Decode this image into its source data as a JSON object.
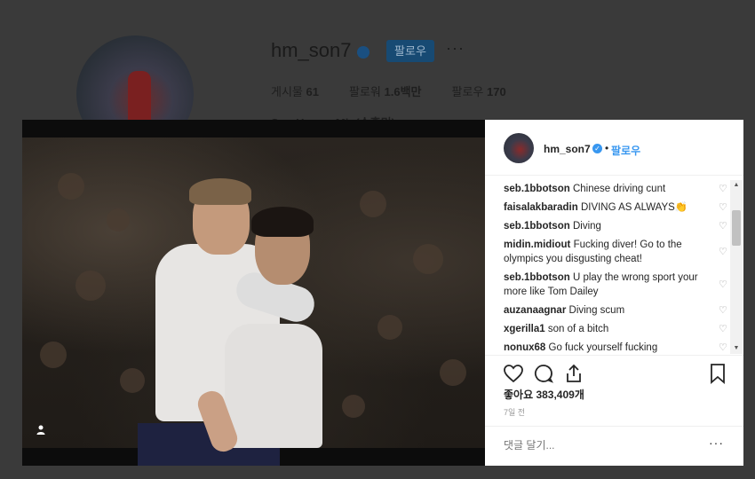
{
  "profile": {
    "username": "hm_son7",
    "follow_label": "팔로우",
    "more_label": "···",
    "stats": [
      {
        "label": "게시물",
        "value": "61"
      },
      {
        "label": "팔로워",
        "value": "1.6백만"
      },
      {
        "label": "팔로우",
        "value": "170"
      }
    ],
    "bio": "Son Heung-Min(손흥민)"
  },
  "post": {
    "username": "hm_son7",
    "follow_label": "팔로우",
    "separator": "•",
    "comments": [
      {
        "user": "seb.1bbotson",
        "text": "Chinese driving cunt"
      },
      {
        "user": "faisalakbaradin",
        "text": "DIVING AS ALWAYS👏"
      },
      {
        "user": "seb.1bbotson",
        "text": "Diving"
      },
      {
        "user": "midin.midiout",
        "text": "Fucking diver! Go to the olympics you disgusting cheat!"
      },
      {
        "user": "seb.1bbotson",
        "text": "U play the wrong sport your more like Tom Dailey"
      },
      {
        "user": "auzanaagnar",
        "text": "Diving scum"
      },
      {
        "user": "xgerilla1",
        "text": "son of a bitch"
      },
      {
        "user": "nonux68",
        "text": "Go fuck yourself fucking"
      }
    ],
    "likes": "좋아요 383,409개",
    "time": "7일 전",
    "comment_placeholder": "댓글 달기...",
    "comment_more": "···"
  },
  "colors": {
    "accent": "#3897f0",
    "modal_bg": "#ffffff",
    "overlay": "#3c3c3c"
  }
}
